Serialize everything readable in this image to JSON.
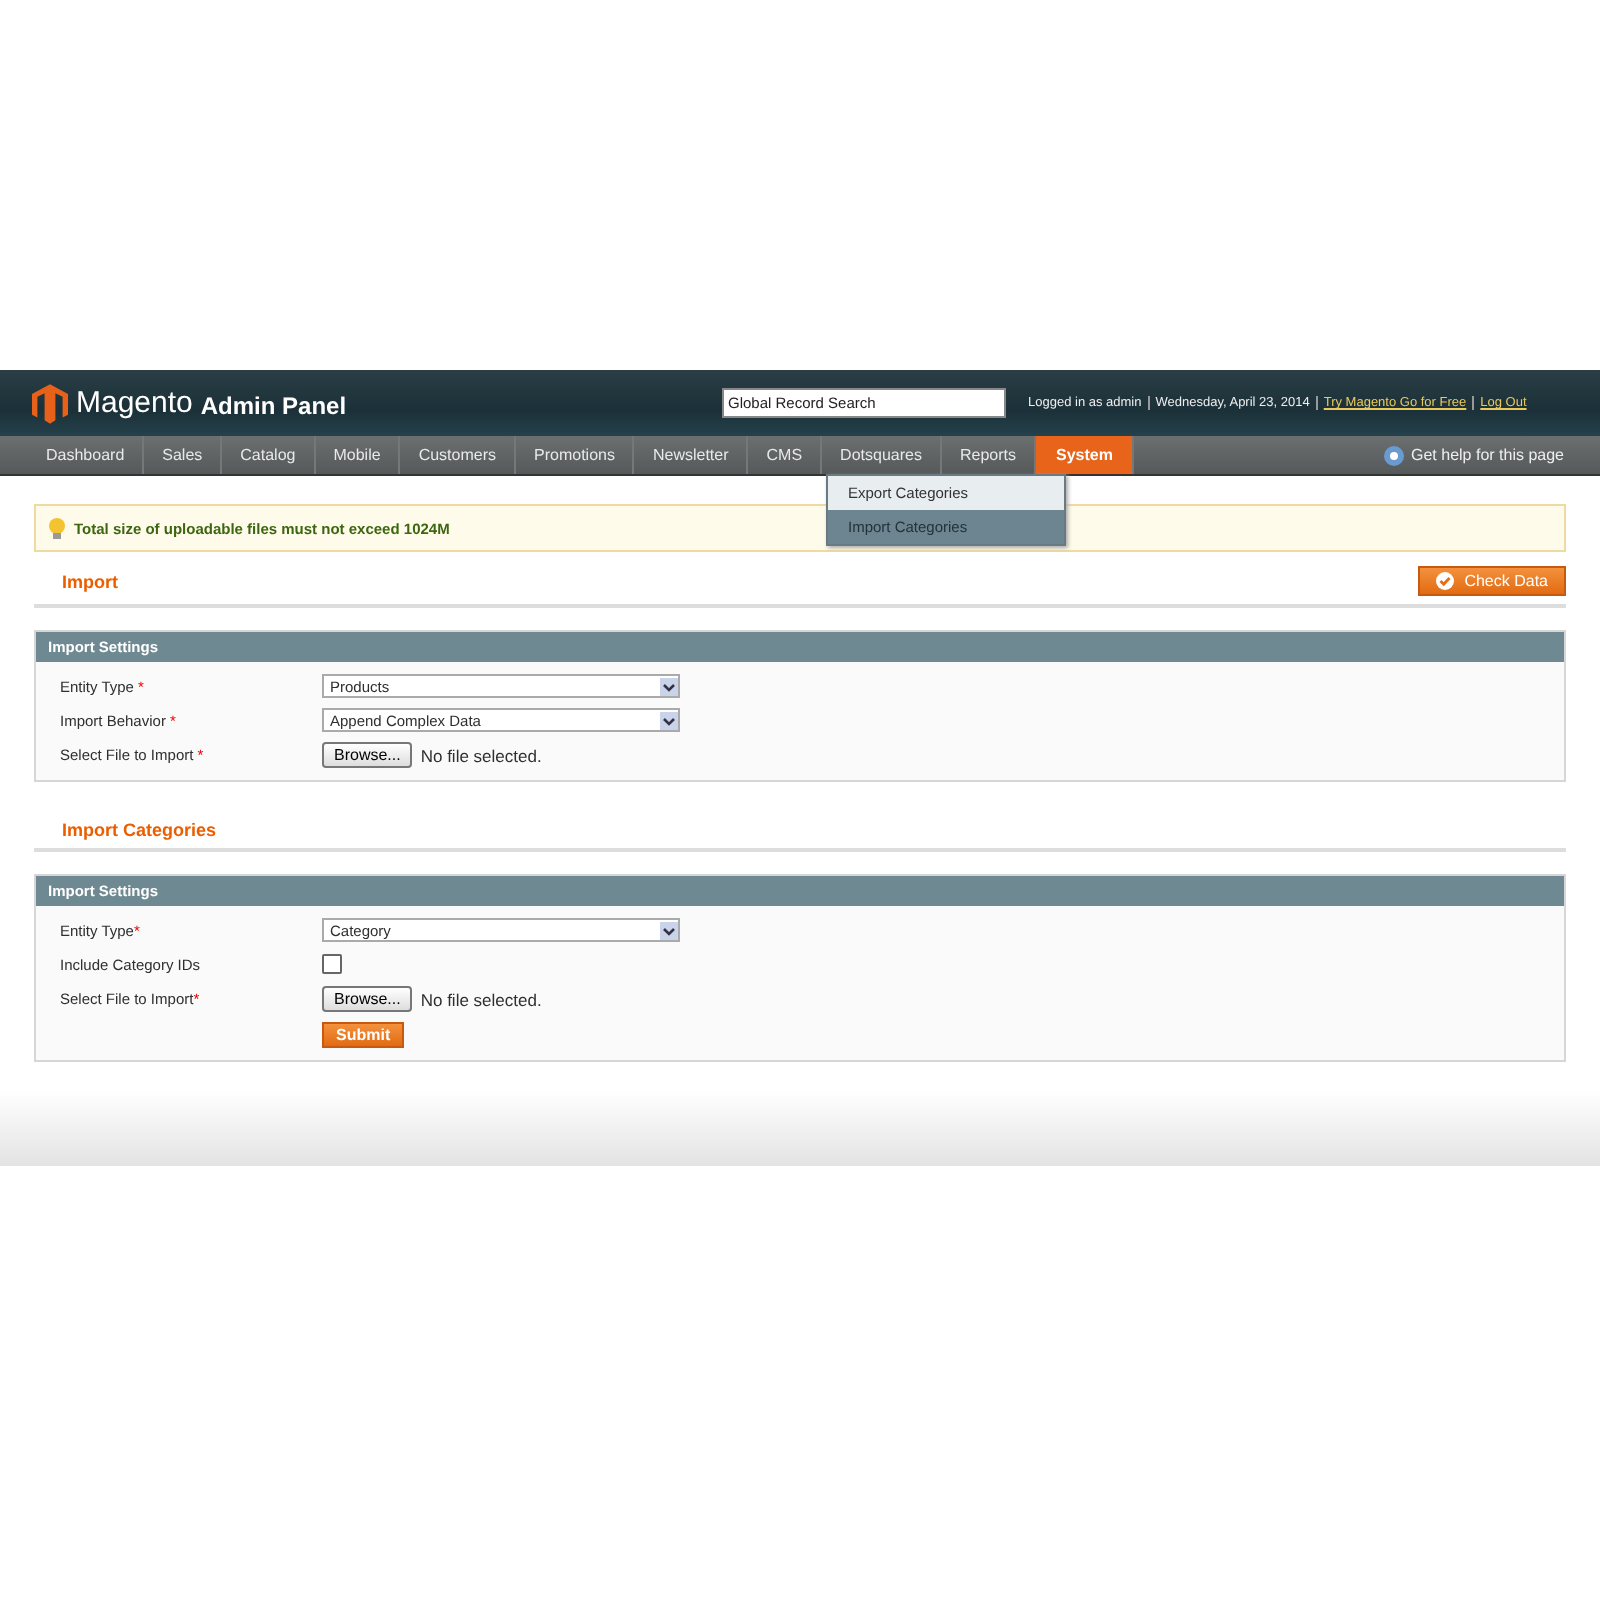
{
  "header": {
    "logo": "Magento",
    "logo_sub": "Admin Panel",
    "search": {
      "value": "Global Record Search"
    },
    "user": "Logged in as admin",
    "date": "Wednesday, April 23, 2014",
    "links": [
      "Try Magento Go for Free",
      "Log Out"
    ]
  },
  "nav": {
    "items": [
      {
        "label": "Dashboard",
        "selected": false
      },
      {
        "label": "Sales",
        "selected": false
      },
      {
        "label": "Catalog",
        "selected": false
      },
      {
        "label": "Mobile",
        "selected": false
      },
      {
        "label": "Customers",
        "selected": false
      },
      {
        "label": "Promotions",
        "selected": false
      },
      {
        "label": "Newsletter",
        "selected": false
      },
      {
        "label": "CMS",
        "selected": false
      },
      {
        "label": "Dotsquares",
        "selected": false
      },
      {
        "label": "Reports",
        "selected": false
      },
      {
        "label": "System",
        "selected": true
      }
    ],
    "help": "Get help for this page",
    "menu": [
      {
        "label": "Export Categories",
        "selected": false
      },
      {
        "label": "Import Categories",
        "selected": true
      }
    ]
  },
  "notice": "Total size of uploadable files must not exceed 1024M",
  "sections": [
    {
      "title": "Import",
      "button": "Check Data",
      "box_title": "Import Settings",
      "rows": [
        {
          "kind": "select",
          "label": "Entity Type",
          "mark": "*",
          "value": "Products"
        },
        {
          "kind": "select",
          "label": "Import Behavior",
          "mark": "*",
          "value": "Append Complex Data"
        },
        {
          "kind": "file",
          "label": "Select File to Import",
          "mark": "*",
          "button": "Browse...",
          "status": "No file selected."
        }
      ]
    },
    {
      "title": "Import Categories",
      "box_title": "Import Settings",
      "rows": [
        {
          "kind": "select",
          "label": "Entity Type",
          "mark": "*",
          "value": "Category"
        },
        {
          "kind": "checkbox",
          "label": "Include Category IDs",
          "checked": false
        },
        {
          "kind": "file",
          "label": "Select File to Import",
          "mark": "*",
          "button": "Browse...",
          "status": "No file selected."
        }
      ],
      "submit": "Submit"
    }
  ]
}
